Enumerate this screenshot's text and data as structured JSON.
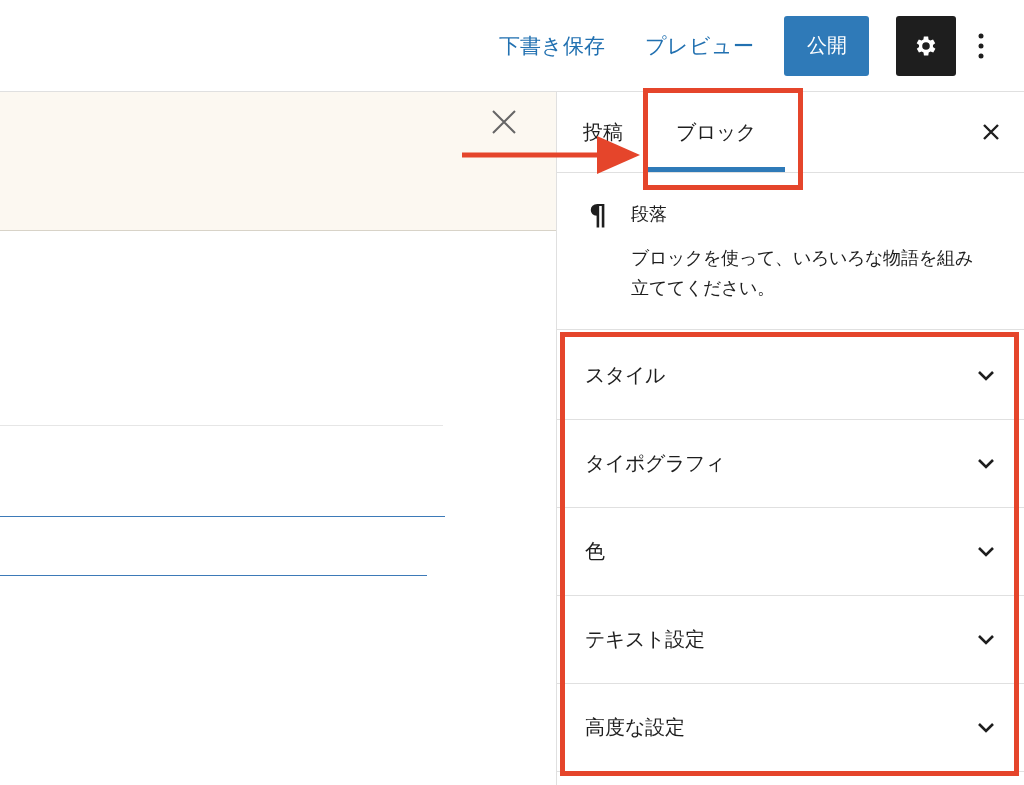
{
  "header": {
    "actions": [
      {
        "kind": "link",
        "label": "下書き保存"
      },
      {
        "kind": "link",
        "label": "プレビュー"
      },
      {
        "kind": "primary",
        "label": "公開"
      }
    ],
    "settings": {
      "pressed": true
    }
  },
  "sidebar": {
    "tabs": [
      {
        "label": "投稿",
        "selected": false
      },
      {
        "label": "ブロック",
        "selected": true
      }
    ],
    "block": {
      "icon": "¶",
      "title": "段落",
      "description": "ブロックを使って、いろいろな物語を組み立ててください。"
    },
    "panels": [
      {
        "title": "スタイル",
        "expanded": false
      },
      {
        "title": "タイポグラフィ",
        "expanded": false
      },
      {
        "title": "色",
        "expanded": false
      },
      {
        "title": "テキスト設定",
        "expanded": false
      },
      {
        "title": "高度な設定",
        "expanded": false
      }
    ]
  }
}
